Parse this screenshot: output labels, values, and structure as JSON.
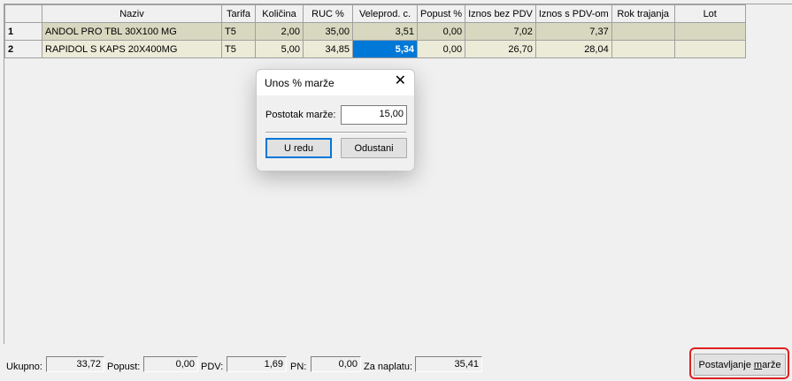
{
  "grid": {
    "columns": [
      "",
      "Naziv",
      "Tarifa",
      "Količina",
      "RUC %",
      "Veleprod. c.",
      "Popust %",
      "Iznos bez PDV",
      "Iznos s PDV-om",
      "Rok trajanja",
      "Lot"
    ],
    "rows": [
      {
        "num": "1",
        "naziv": "ANDOL PRO TBL 30X100 MG",
        "tarifa": "T5",
        "kolicina": "2,00",
        "ruc": "35,00",
        "veleprod": "3,51",
        "popust": "0,00",
        "bez_pdv": "7,02",
        "s_pdv": "7,37",
        "rok": "",
        "lot": ""
      },
      {
        "num": "2",
        "naziv": "RAPIDOL S KAPS 20X400MG",
        "tarifa": "T5",
        "kolicina": "5,00",
        "ruc": "34,85",
        "veleprod": "5,34",
        "popust": "0,00",
        "bez_pdv": "26,70",
        "s_pdv": "28,04",
        "rok": "",
        "lot": ""
      }
    ]
  },
  "totals": {
    "ukupno_label": "Ukupno:",
    "ukupno": "33,72",
    "popust_label": "Popust:",
    "popust": "0,00",
    "pdv_label": "PDV:",
    "pdv": "1,69",
    "pn_label": "PN:",
    "pn": "0,00",
    "za_naplatu_label": "Za naplatu:",
    "za_naplatu": "35,41"
  },
  "main_button": {
    "prefix": "Postavljanje ",
    "underlined": "m",
    "suffix": "arže"
  },
  "dialog": {
    "title": "Unos % marže",
    "close_glyph": "✕",
    "field_label": "Postotak marže:",
    "field_value": "15,00",
    "ok_label": "U redu",
    "cancel_label": "Odustani"
  },
  "colors": {
    "selection": "#0078d7",
    "row1": "#d8d8c0",
    "row2": "#ebebd8",
    "highlight_ring": "#e02020"
  }
}
